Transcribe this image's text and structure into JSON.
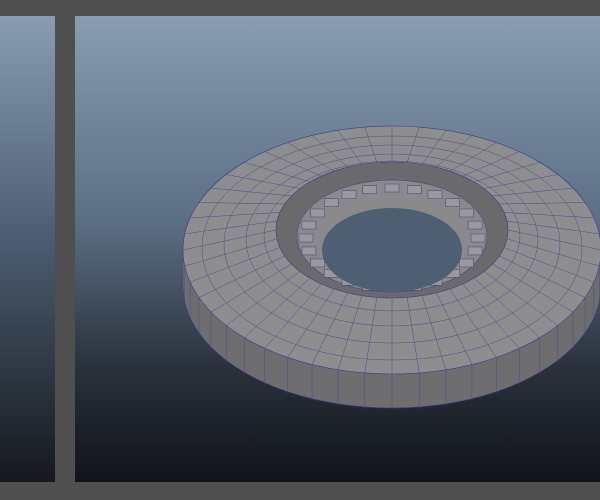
{
  "colors": {
    "chrome": "#505050",
    "viewport_top": "#889cb2",
    "viewport_bottom": "#111318",
    "mesh_face": "#8c8c8e",
    "wireframe": "#3a3a8a"
  }
}
